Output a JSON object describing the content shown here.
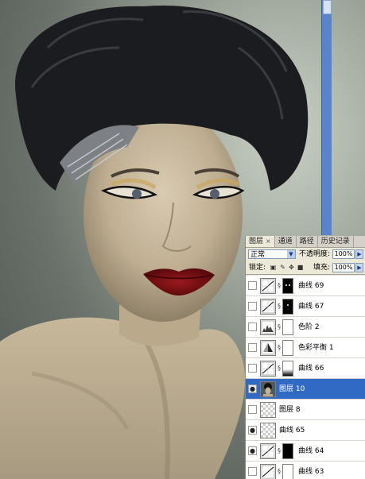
{
  "panel": {
    "tabs": [
      {
        "label": "图层",
        "close": "×"
      },
      {
        "label": "通道"
      },
      {
        "label": "路径"
      },
      {
        "label": "历史记录"
      }
    ],
    "blend_mode": "正常",
    "opacity_label": "不透明度:",
    "opacity_value": "100%",
    "lock_label": "锁定:",
    "fill_label": "填充:",
    "fill_value": "100%",
    "layers": [
      {
        "name": "曲线 69",
        "type": "curves",
        "mask": "black-dots",
        "selected": false,
        "visible": false
      },
      {
        "name": "曲线 67",
        "type": "curves",
        "mask": "black-dots",
        "selected": false,
        "visible": false
      },
      {
        "name": "色阶 2",
        "type": "levels",
        "mask": "white",
        "selected": false,
        "visible": false
      },
      {
        "name": "色彩平衡 1",
        "type": "color-balance",
        "mask": "white",
        "selected": false,
        "visible": false
      },
      {
        "name": "曲线 66",
        "type": "curves",
        "mask": "white-gradient",
        "selected": false,
        "visible": false
      },
      {
        "name": "图层 10",
        "type": "photo",
        "mask": "",
        "selected": true,
        "visible": true
      },
      {
        "name": "图层 8",
        "type": "transparent",
        "mask": "",
        "selected": false,
        "visible": false
      },
      {
        "name": "曲线 65",
        "type": "transparent",
        "mask": "",
        "selected": false,
        "visible": true
      },
      {
        "name": "曲线 64",
        "type": "curves",
        "mask": "black",
        "selected": false,
        "visible": true
      },
      {
        "name": "曲线 63",
        "type": "curves",
        "mask": "white",
        "selected": false,
        "visible": false
      }
    ]
  },
  "colors": {
    "selection": "#316ac5",
    "panel_bg": "#ece9d8",
    "lips": "#7a0f14"
  }
}
